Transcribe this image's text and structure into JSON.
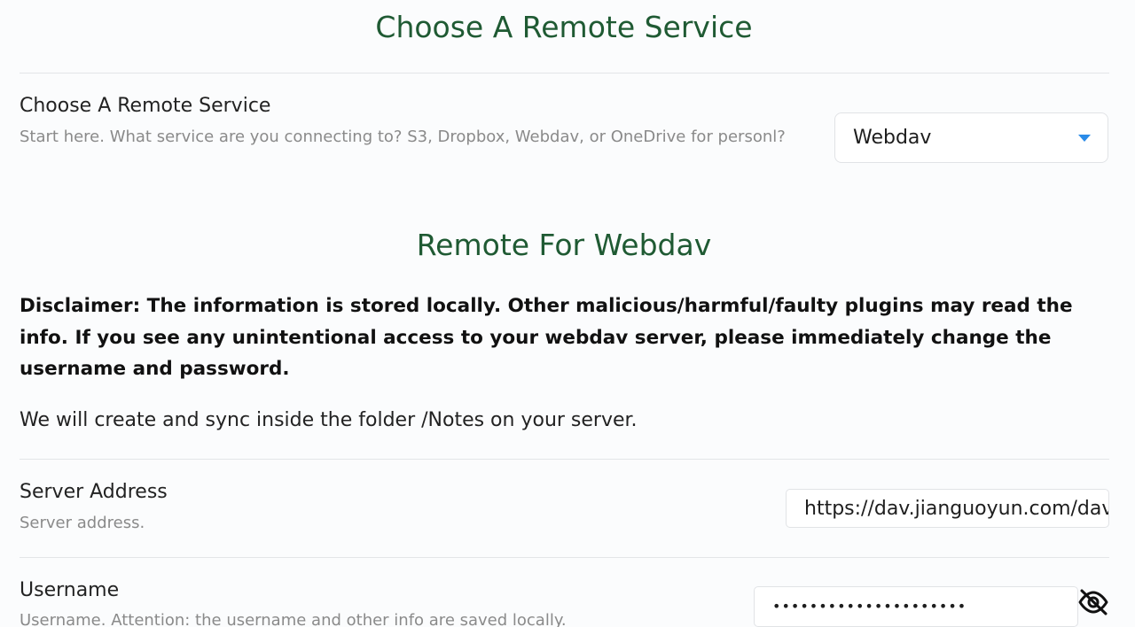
{
  "section1": {
    "heading": "Choose A Remote Service"
  },
  "service_setting": {
    "name": "Choose A Remote Service",
    "description": "Start here. What service are you connecting to? S3, Dropbox, Webdav, or OneDrive for personl?",
    "selected": "Webdav"
  },
  "section2": {
    "heading": "Remote For Webdav",
    "disclaimer": "Disclaimer: The information is stored locally. Other malicious/harmful/faulty plugins may read the info. If you see any unintentional access to your webdav server, please immediately change the username and password.",
    "info": "We will create and sync inside the folder /Notes on your server."
  },
  "server_address": {
    "name": "Server Address",
    "description": "Server address.",
    "value": "https://dav.jianguoyun.com/dav/"
  },
  "username": {
    "name": "Username",
    "description": "Username. Attention: the username and other info are saved locally.",
    "value": "•••••••••••••••••••••",
    "toggle_icon": "eye-off-icon"
  },
  "colors": {
    "heading": "#1f5a33",
    "accent": "#2a8be8",
    "muted_text": "#8a8a8a"
  }
}
